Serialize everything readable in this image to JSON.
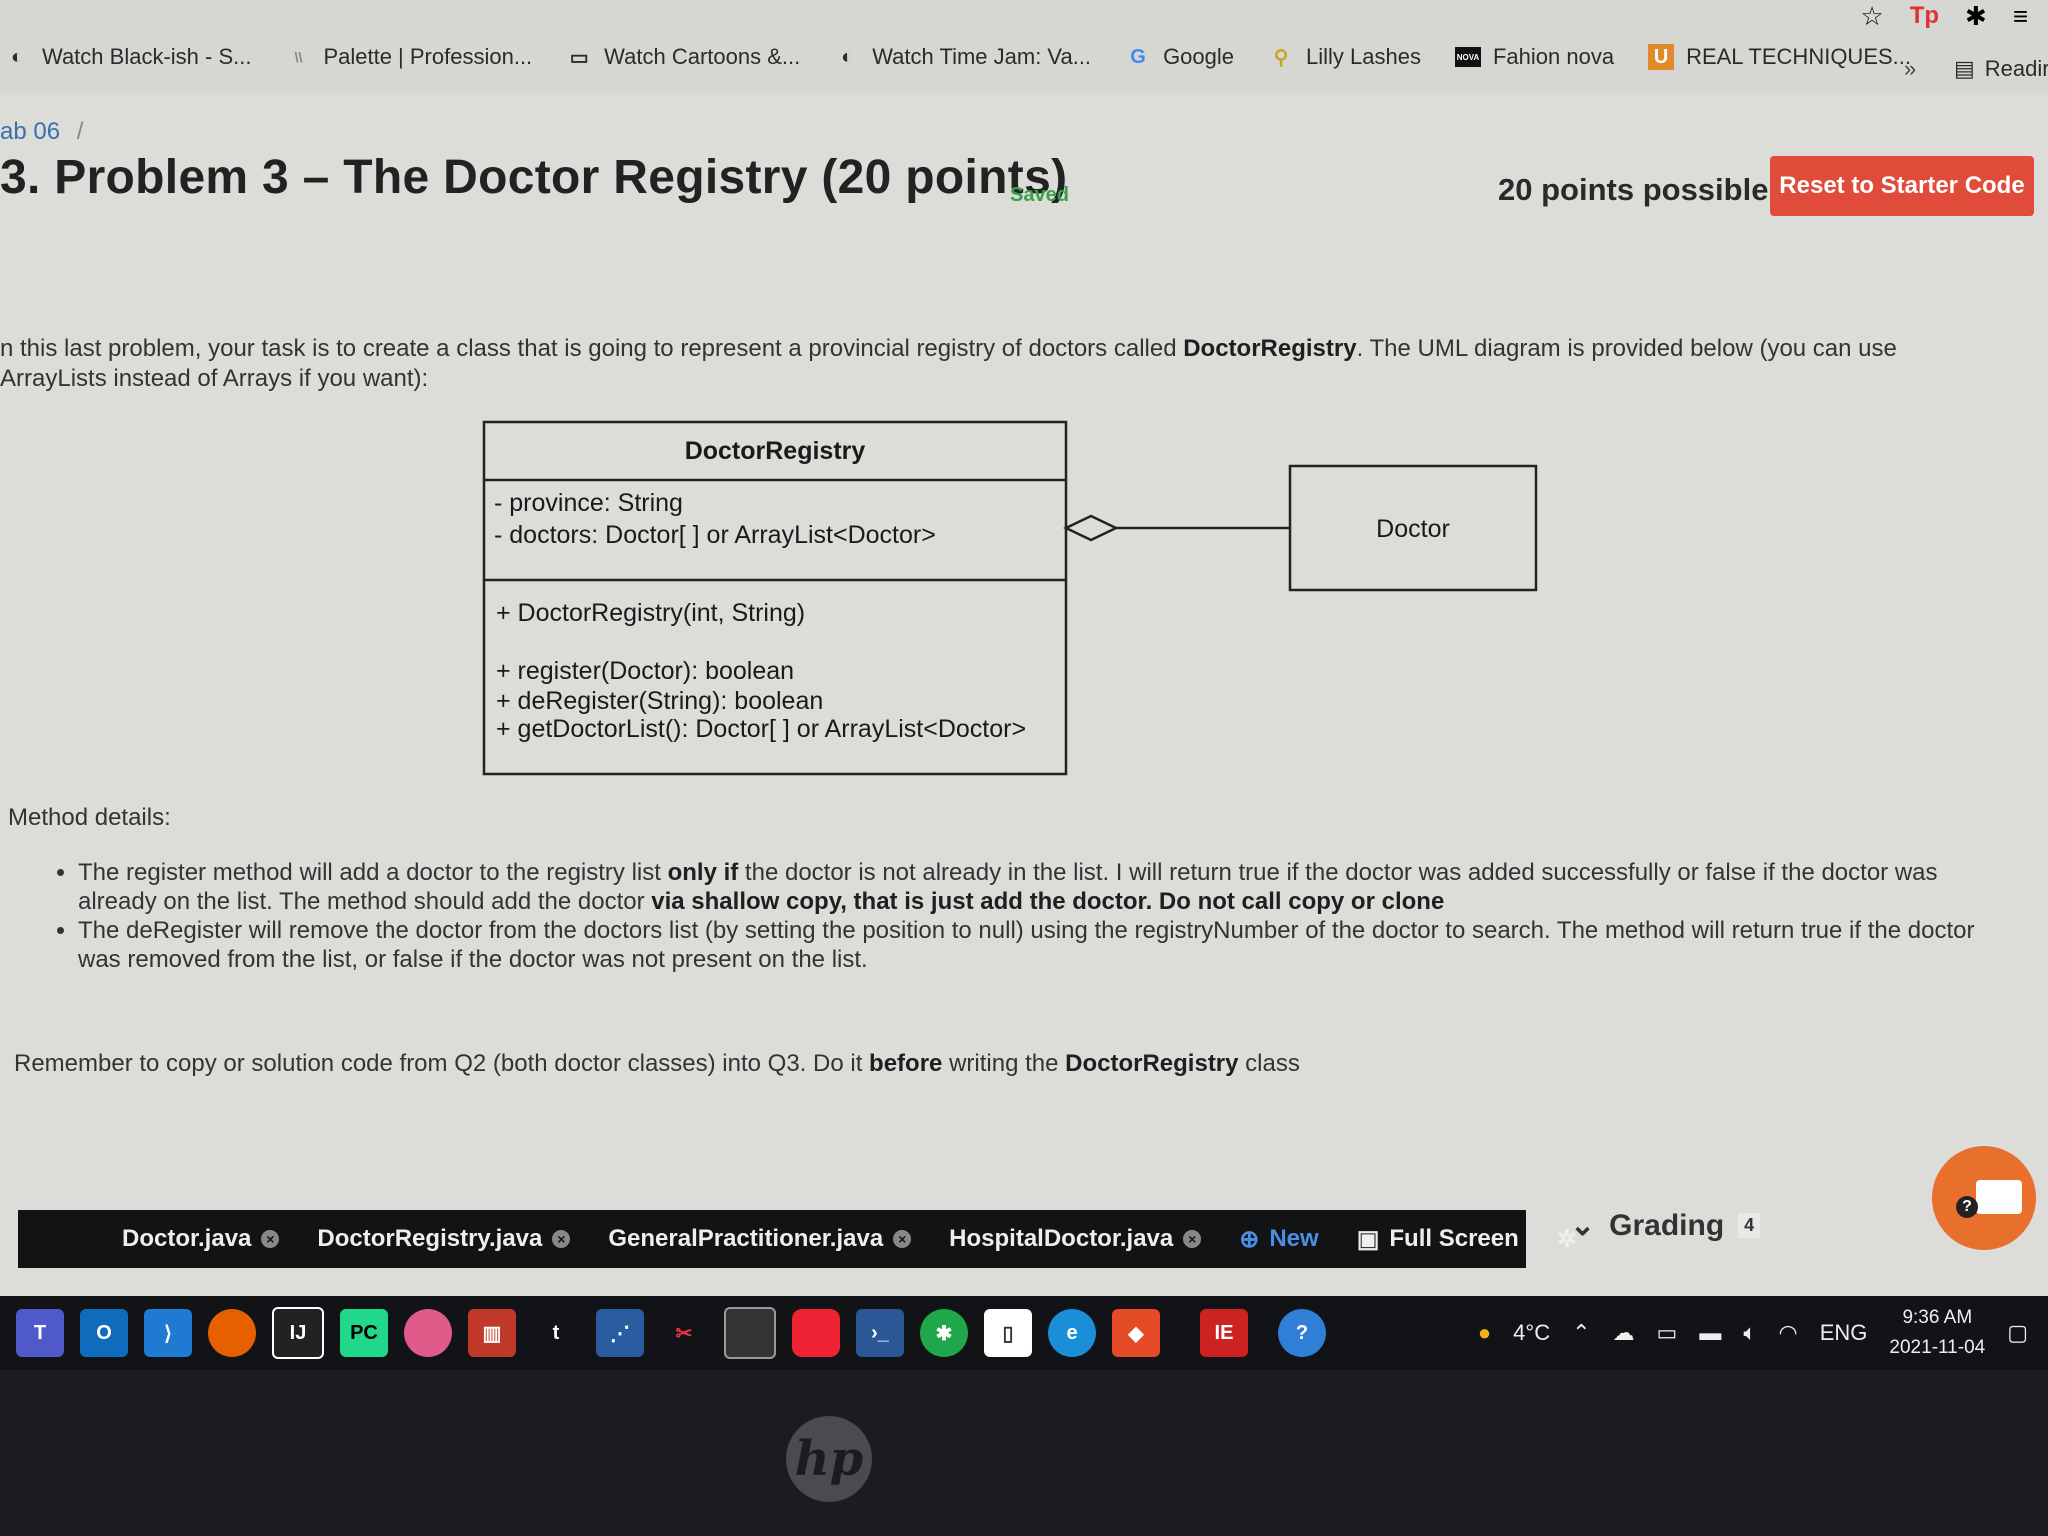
{
  "browser": {
    "bookmarks": [
      {
        "label": "Watch Black-ish - S...",
        "icon": "globe-icon"
      },
      {
        "label": "Palette | Profession...",
        "icon": "palette-icon"
      },
      {
        "label": "Watch Cartoons &...",
        "icon": "tv-icon"
      },
      {
        "label": "Watch Time Jam: Va...",
        "icon": "globe-icon"
      },
      {
        "label": "Google",
        "icon": "google-icon"
      },
      {
        "label": "Lilly Lashes",
        "icon": "lashes-icon"
      },
      {
        "label": "Fahion nova",
        "icon": "nova-icon"
      },
      {
        "label": "REAL TECHNIQUES...",
        "icon": "rt-icon"
      }
    ],
    "more_label": "»",
    "reading_list_label": "Readir"
  },
  "page": {
    "breadcrumb": "ab 06",
    "breadcrumb_sep": "/",
    "title": "3. Problem 3 – The Doctor Registry (20 points)",
    "saved": "Saved",
    "points_possible": "20 points possible",
    "reset_button": "Reset to Starter Code",
    "intro_1": "n this last problem, your task is to create a class that is going to represent a provincial registry of doctors called ",
    "intro_bold": "DoctorRegistry",
    "intro_2": ". The UML diagram is provided below (you can use ArrayLists instead of Arrays if you want):",
    "uml": {
      "class_name": "DoctorRegistry",
      "attr_1": "- province: String",
      "attr_2": "- doctors: Doctor[ ] or ArrayList<Doctor>",
      "method_1": "+ DoctorRegistry(int, String)",
      "method_2": "+ register(Doctor): boolean",
      "method_3": "+ deRegister(String): boolean",
      "method_4": "+ getDoctorList(): Doctor[ ] or ArrayList<Doctor>",
      "other_class": "Doctor"
    },
    "method_details_heading": "Method details:",
    "detail_1_a": "The register method will add a doctor to the registry list ",
    "detail_1_bold": "only if",
    "detail_1_b": " the doctor is not already in the list. I will return true if the doctor was added successfully or false if the doctor was already on the list. The method should add the doctor ",
    "detail_1_bold2": "via shallow copy, that is just add the doctor. Do not call copy or clone",
    "detail_2": "The deRegister will remove the doctor from the doctors list (by setting the position to null) using the registryNumber of the doctor to search. The method will return true if the doctor was removed from the list, or false if the doctor was not present on the list.",
    "reminder_a": "Remember to copy or solution code from Q2 (both doctor classes) into Q3. Do it ",
    "reminder_bold": "before",
    "reminder_b": " writing the ",
    "reminder_bold2": "DoctorRegistry",
    "reminder_c": " class"
  },
  "editor": {
    "tabs": [
      "Doctor.java",
      "DoctorRegistry.java",
      "GeneralPractitioner.java",
      "HospitalDoctor.java"
    ],
    "new_label": "New",
    "fullscreen_label": "Full Screen",
    "grading_label": "Grading",
    "grading_count": "4"
  },
  "taskbar": {
    "weather": "4°C",
    "lang": "ENG",
    "time": "9:36 AM",
    "date": "2021-11-04"
  },
  "colors": {
    "accent": "#e04b3a",
    "link": "#3a6fb0",
    "saved": "#3aa04a"
  }
}
